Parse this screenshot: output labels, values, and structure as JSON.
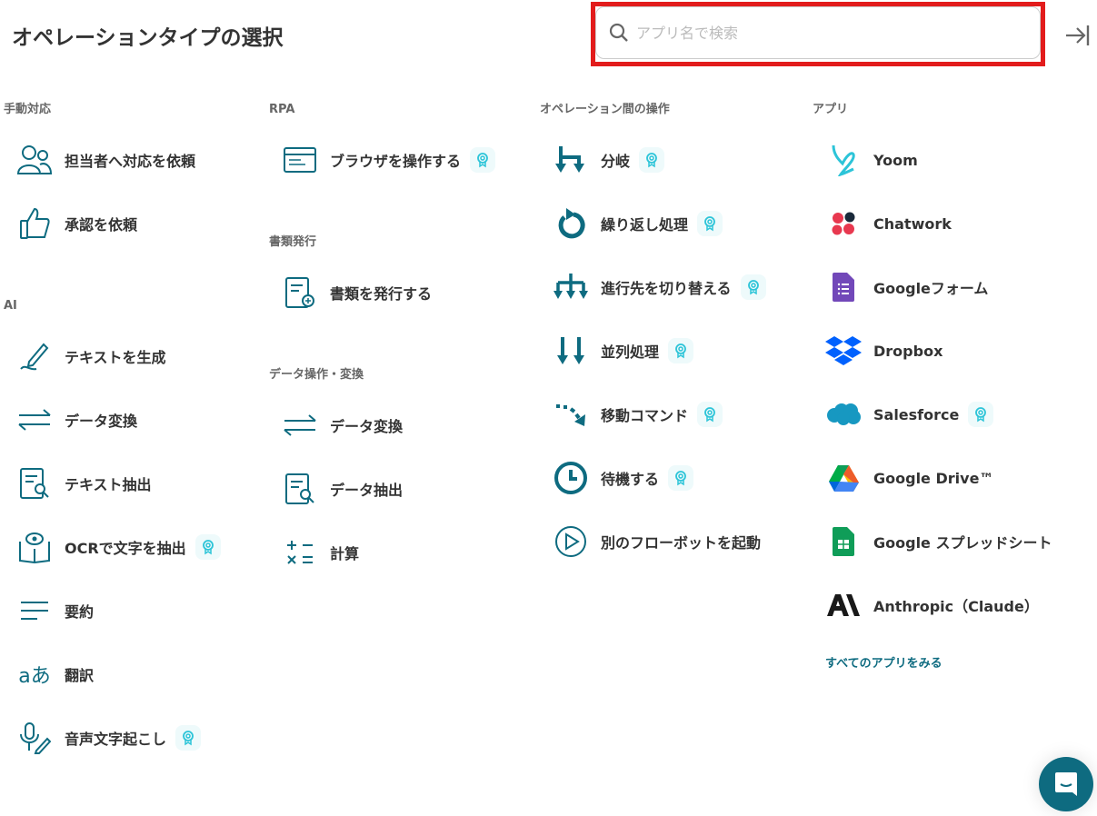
{
  "header": {
    "title": "オペレーションタイプの選択",
    "search_placeholder": "アプリ名で検索"
  },
  "sections": {
    "manual": {
      "heading": "手動対応",
      "items": [
        "担当者へ対応を依頼",
        "承認を依頼"
      ]
    },
    "ai": {
      "heading": "AI",
      "items": [
        "テキストを生成",
        "データ変換",
        "テキスト抽出",
        "OCRで文字を抽出",
        "要約",
        "翻訳",
        "音声文字起こし"
      ]
    },
    "rpa": {
      "heading": "RPA",
      "items": [
        "ブラウザを操作する"
      ]
    },
    "docs": {
      "heading": "書類発行",
      "items": [
        "書類を発行する"
      ]
    },
    "data": {
      "heading": "データ操作・変換",
      "items": [
        "データ変換",
        "データ抽出",
        "計算"
      ]
    },
    "flow": {
      "heading": "オペレーション間の操作",
      "items": [
        "分岐",
        "繰り返し処理",
        "進行先を切り替える",
        "並列処理",
        "移動コマンド",
        "待機する",
        "別のフローボットを起動"
      ]
    },
    "apps": {
      "heading": "アプリ",
      "items": [
        "Yoom",
        "Chatwork",
        "Googleフォーム",
        "Dropbox",
        "Salesforce",
        "Google Drive™",
        "Google スプレッドシート",
        "Anthropic（Claude）"
      ],
      "see_all": "すべてのアプリをみる"
    }
  },
  "colors": {
    "accent": "#0e6b80",
    "highlight": "#e21c1c",
    "badge": "#2cc4d8"
  }
}
